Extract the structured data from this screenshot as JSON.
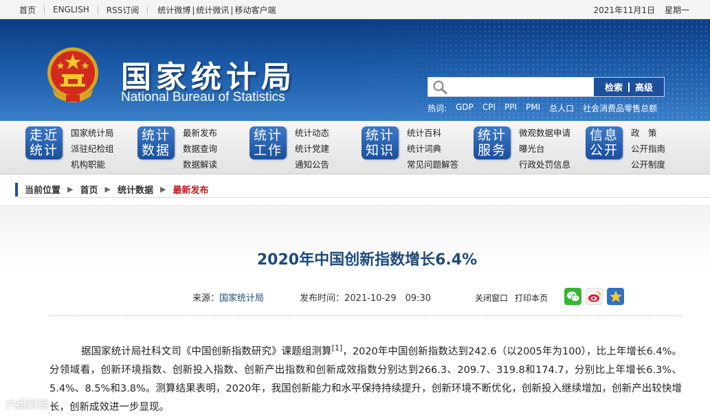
{
  "topbar": {
    "home": "首页",
    "english": "ENGLISH",
    "rss": "RSS订阅",
    "weibo": "统计微博",
    "wechat": "统计微讯",
    "mobile": "移动客户端",
    "date": "2021年11月1日",
    "weekday": "星期一"
  },
  "header": {
    "title": "国家统计局",
    "subtitle": "National Bureau of Statistics",
    "search_placeholder": "",
    "search_button": "检索",
    "advanced_button": "高级",
    "hot_label": "热词:",
    "hot_words": [
      "GDP",
      "CPI",
      "PPI",
      "PMI",
      "总人口",
      "社会消费品零售总额"
    ]
  },
  "nav": [
    {
      "tile": [
        "走近",
        "统计"
      ],
      "links": [
        "国家统计局",
        "派驻纪检组",
        "机构职能"
      ]
    },
    {
      "tile": [
        "统计",
        "数据"
      ],
      "links": [
        "最新发布",
        "数据查询",
        "数据解读"
      ]
    },
    {
      "tile": [
        "统计",
        "工作"
      ],
      "links": [
        "统计动态",
        "统计党建",
        "通知公告"
      ]
    },
    {
      "tile": [
        "统计",
        "知识"
      ],
      "links": [
        "统计百科",
        "统计词典",
        "常见问题解答"
      ]
    },
    {
      "tile": [
        "统计",
        "服务"
      ],
      "links": [
        "微观数据申请",
        "曝光台",
        "行政处罚信息"
      ]
    },
    {
      "tile": [
        "信息",
        "公开"
      ],
      "links": [
        "政　策",
        "公开指南",
        "公开制度"
      ]
    }
  ],
  "breadcrumb": {
    "label": "当前位置",
    "arrow": "▶",
    "items": [
      "首页",
      "统计数据"
    ],
    "current": "最新发布"
  },
  "article": {
    "title": "2020年中国创新指数增长6.4%",
    "source_label": "来源：",
    "source": "国家统计局",
    "time_label": "发布时间：",
    "time": "2021-10-29　09:30",
    "close_window": "关闭窗口",
    "print_page": "打印本页",
    "paragraph_before_sup": "据国家统计局社科文司《中国创新指数研究》课题组测算",
    "footnote": "[1]",
    "paragraph_after_sup": "，2020年中国创新指数达到242.6（以2005年为100），比上年增长6.4%。分领域看，创新环境指数、创新投入指数、创新产出指数和创新成效指数分别达到266.3、209.7、319.8和174.7，分别比上年增长6.3%、5.4%、8.5%和3.8%。测算结果表明，2020年，我国创新能力和水平保持持续提升，创新环境不断优化，创新投入继续增加，创新产出较快增长，创新成效进一步显现。"
  },
  "watermark": "六维财经",
  "icons": {
    "emblem": "national-emblem-icon",
    "search": "search-icon",
    "wechat": "wechat-share-icon",
    "weibo": "weibo-share-icon",
    "favorite": "favorite-star-icon"
  },
  "colors": {
    "banner": "#1b5aa8",
    "nav_tile": "#1b4f9e",
    "title": "#1e4b7a",
    "crumb_current": "#c4161c"
  }
}
